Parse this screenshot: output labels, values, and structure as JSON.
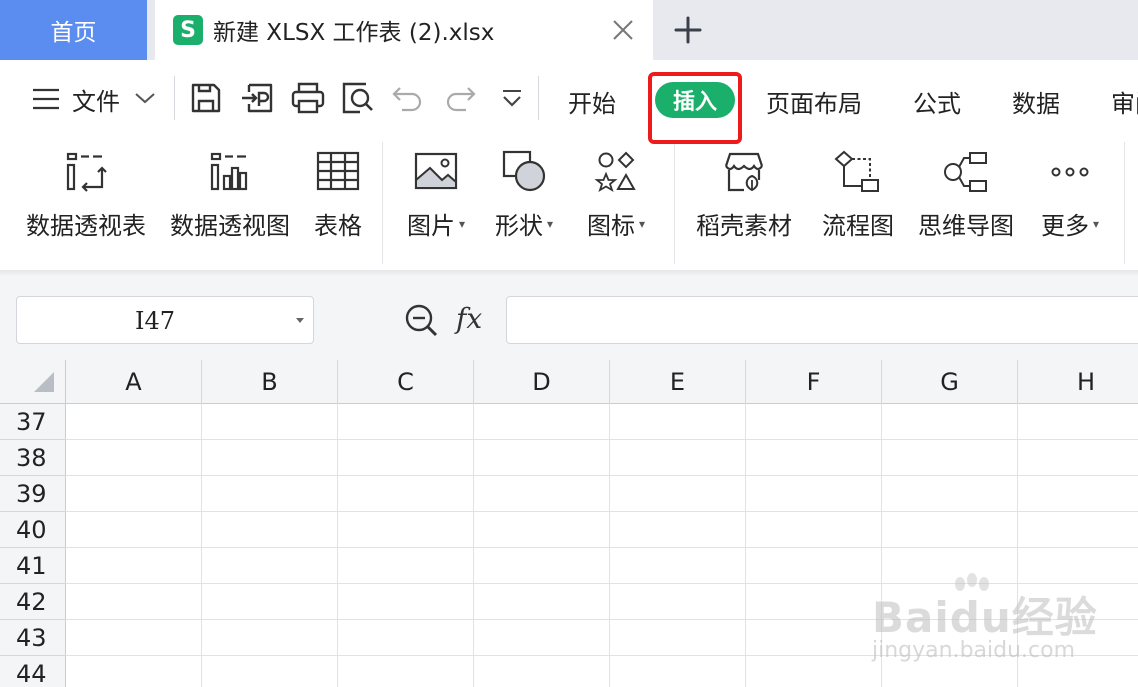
{
  "tabs": {
    "home_label": "首页",
    "file_icon_letter": "S",
    "file_name": "新建 XLSX 工作表 (2).xlsx"
  },
  "menu": {
    "file_label": "文件",
    "tabs": [
      "开始",
      "插入",
      "页面布局",
      "公式",
      "数据",
      "审阅"
    ],
    "active_tab": "插入"
  },
  "ribbon": {
    "items": [
      {
        "label": "数据透视表",
        "icon": "pivot-table-icon",
        "has_dropdown": false
      },
      {
        "label": "数据透视图",
        "icon": "pivot-chart-icon",
        "has_dropdown": false
      },
      {
        "label": "表格",
        "icon": "table-icon",
        "has_dropdown": false
      },
      {
        "label": "图片",
        "icon": "picture-icon",
        "has_dropdown": true
      },
      {
        "label": "形状",
        "icon": "shape-icon",
        "has_dropdown": true
      },
      {
        "label": "图标",
        "icon": "icons-icon",
        "has_dropdown": true
      },
      {
        "label": "稻壳素材",
        "icon": "docer-material-icon",
        "has_dropdown": false
      },
      {
        "label": "流程图",
        "icon": "flowchart-icon",
        "has_dropdown": false
      },
      {
        "label": "思维导图",
        "icon": "mindmap-icon",
        "has_dropdown": false
      },
      {
        "label": "更多",
        "icon": "more-icon",
        "has_dropdown": true
      }
    ]
  },
  "formula_bar": {
    "cell_reference": "I47",
    "fx_label": "fx",
    "formula_value": ""
  },
  "sheet": {
    "columns": [
      "A",
      "B",
      "C",
      "D",
      "E",
      "F",
      "G",
      "H"
    ],
    "rows": [
      "37",
      "38",
      "39",
      "40",
      "41",
      "42",
      "43",
      "44"
    ]
  },
  "watermark": {
    "brand": "Baidu经验",
    "url": "jingyan.baidu.com"
  },
  "colors": {
    "home_tab": "#5b8cf0",
    "accent_green": "#1aaf6b",
    "highlight_red": "#ee1b1b"
  }
}
